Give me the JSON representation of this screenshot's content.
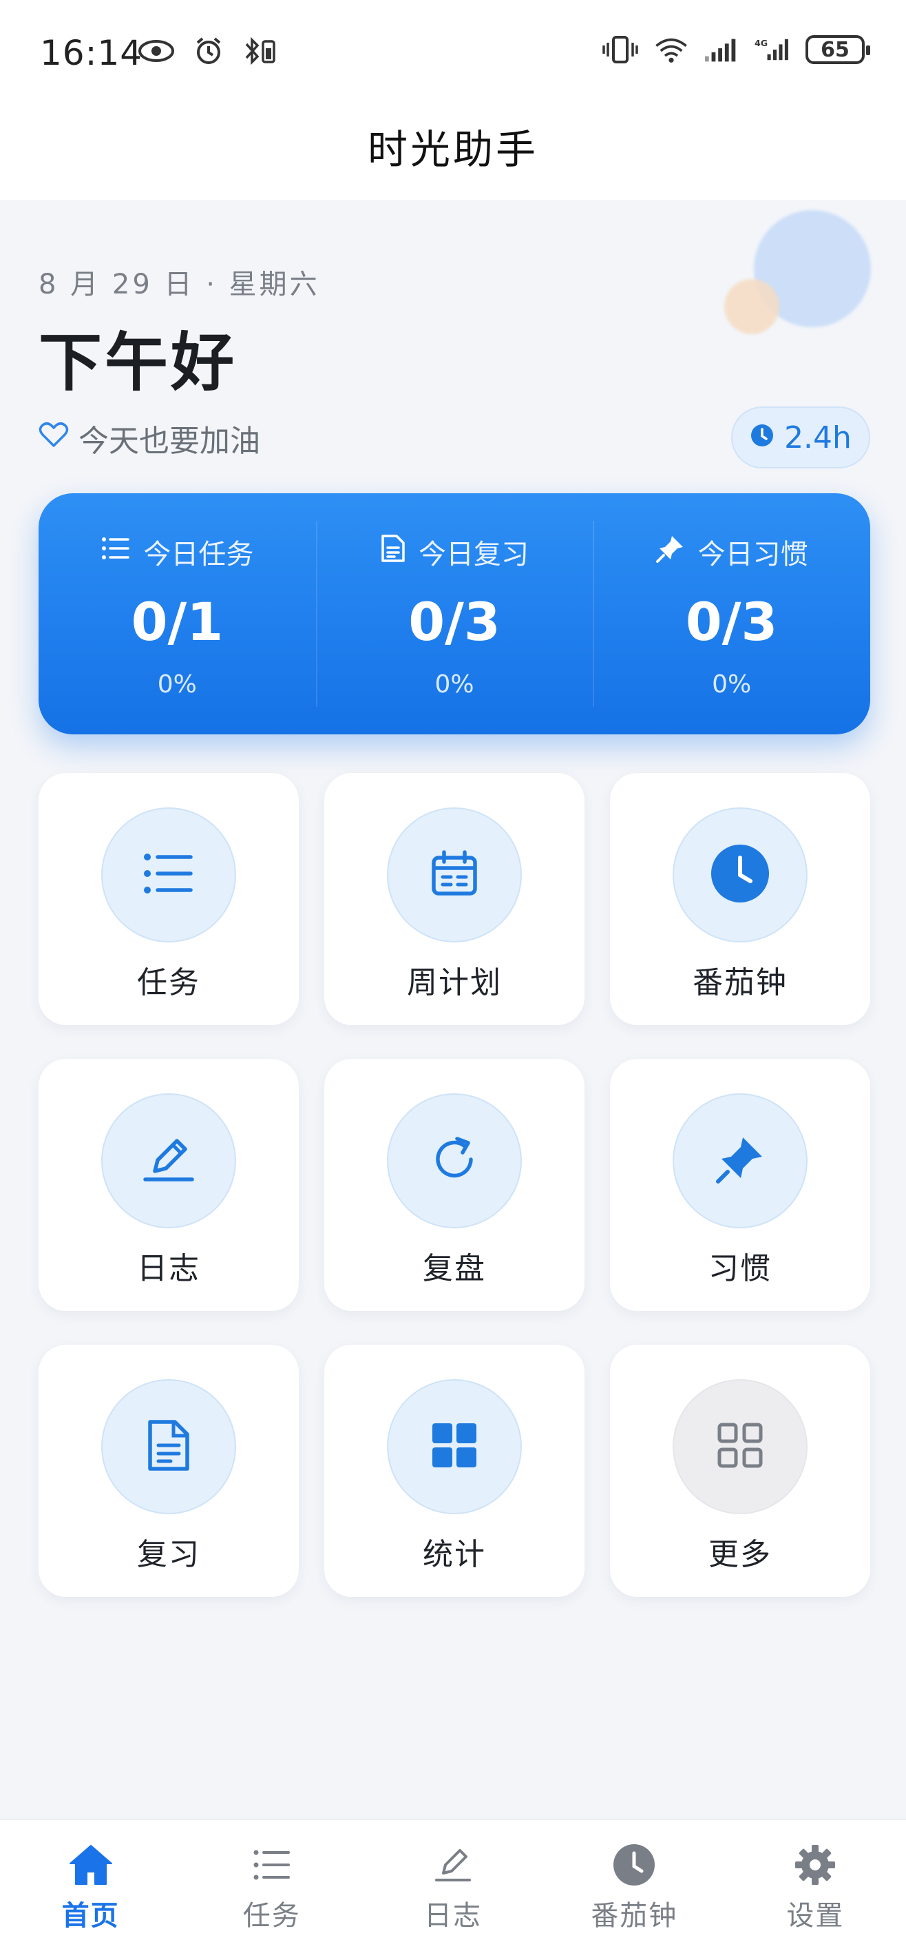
{
  "status_bar": {
    "time": "16:14",
    "battery": "65"
  },
  "app": {
    "title": "时光助手"
  },
  "greeting": {
    "date": "8 月 29 日 · 星期六",
    "text": "下午好",
    "cheer": "今天也要加油",
    "hours": "2.4h"
  },
  "summary": [
    {
      "label": "今日任务",
      "value": "0/1",
      "percent": "0%",
      "icon": "list-icon"
    },
    {
      "label": "今日复习",
      "value": "0/3",
      "percent": "0%",
      "icon": "document-icon"
    },
    {
      "label": "今日习惯",
      "value": "0/3",
      "percent": "0%",
      "icon": "pin-icon"
    }
  ],
  "tiles": [
    {
      "label": "任务",
      "icon": "list-icon"
    },
    {
      "label": "周计划",
      "icon": "calendar-icon"
    },
    {
      "label": "番茄钟",
      "icon": "clock-icon"
    },
    {
      "label": "日志",
      "icon": "pencil-icon"
    },
    {
      "label": "复盘",
      "icon": "refresh-icon"
    },
    {
      "label": "习惯",
      "icon": "pin-icon"
    },
    {
      "label": "复习",
      "icon": "document-icon"
    },
    {
      "label": "统计",
      "icon": "grid-icon"
    },
    {
      "label": "更多",
      "icon": "apps-icon"
    }
  ],
  "nav": [
    {
      "label": "首页",
      "icon": "home-icon",
      "active": true
    },
    {
      "label": "任务",
      "icon": "list-icon",
      "active": false
    },
    {
      "label": "日志",
      "icon": "pencil-icon",
      "active": false
    },
    {
      "label": "番茄钟",
      "icon": "clock-icon",
      "active": false
    },
    {
      "label": "设置",
      "icon": "gear-icon",
      "active": false
    }
  ],
  "colors": {
    "accent": "#1a73e8",
    "card_gradient_top": "#2e8ff5",
    "card_gradient_bottom": "#1572e6",
    "background": "#f3f5f9"
  }
}
